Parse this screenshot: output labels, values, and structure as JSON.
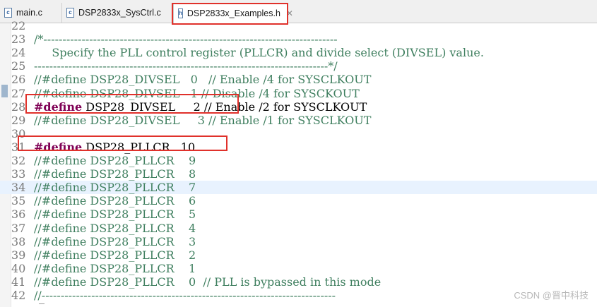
{
  "tabs": [
    {
      "icon": "c-file-icon",
      "label": "main.c",
      "active": false
    },
    {
      "icon": "c-file-icon",
      "label": "DSP2833x_SysCtrl.c",
      "active": false
    },
    {
      "icon": "h-file-icon",
      "label": "DSP2833x_Examples.h",
      "active": true
    }
  ],
  "editor": {
    "lines": [
      {
        "num": "22",
        "text": ""
      },
      {
        "num": "23",
        "text": "/*-----------------------------------------------------------------------------"
      },
      {
        "num": "24",
        "text": "     Specify the PLL control register (PLLCR) and divide select (DIVSEL) value."
      },
      {
        "num": "25",
        "text": "-----------------------------------------------------------------------------*/"
      },
      {
        "num": "26",
        "text": "//#define DSP28_DIVSEL   0   // Enable /4 for SYSCLKOUT"
      },
      {
        "num": "27",
        "text": "//#define DSP28_DIVSEL   1 // Disable /4 for SYSCKOUT"
      },
      {
        "num": "28",
        "kw": "#define",
        "rest": " DSP28_DIVSEL     2 // Enable /2 for SYSCLKOUT"
      },
      {
        "num": "29",
        "text": "//#define DSP28_DIVSEL     3 // Enable /1 for SYSCLKOUT"
      },
      {
        "num": "30",
        "text": ""
      },
      {
        "num": "31",
        "kw": "#define",
        "rest": " DSP28_PLLCR   10"
      },
      {
        "num": "32",
        "text": "//#define DSP28_PLLCR    9"
      },
      {
        "num": "33",
        "text": "//#define DSP28_PLLCR    8"
      },
      {
        "num": "34",
        "text": "//#define DSP28_PLLCR    7"
      },
      {
        "num": "35",
        "text": "//#define DSP28_PLLCR    6"
      },
      {
        "num": "36",
        "text": "//#define DSP28_PLLCR    5"
      },
      {
        "num": "37",
        "text": "//#define DSP28_PLLCR    4"
      },
      {
        "num": "38",
        "text": "//#define DSP28_PLLCR    3"
      },
      {
        "num": "39",
        "text": "//#define DSP28_PLLCR    2"
      },
      {
        "num": "40",
        "text": "//#define DSP28_PLLCR    1"
      },
      {
        "num": "41",
        "text": "//#define DSP28_PLLCR    0  // PLL is bypassed in this mode"
      },
      {
        "num": "42",
        "text": "//-----------------------------------------------------------------------------"
      }
    ],
    "highlighted_line": "34"
  },
  "watermark": "CSDN @晋中科技",
  "colors": {
    "comment": "#3f7f5f",
    "keyword": "#7f0055",
    "annotation": "#e0312b",
    "line_highlight": "#e8f2fe"
  }
}
